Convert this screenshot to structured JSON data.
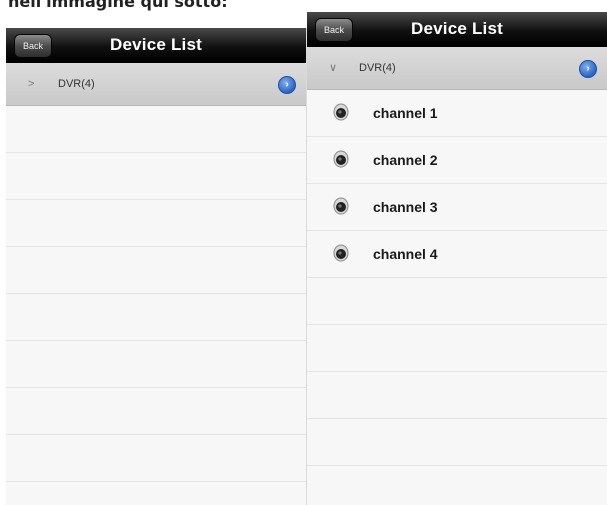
{
  "caption": "nell'immagine qui sotto:",
  "left": {
    "back_label": "Back",
    "title": "Device List",
    "group": {
      "expander": ">",
      "label": "DVR(4)",
      "disclosure": "›"
    }
  },
  "right": {
    "back_label": "Back",
    "title": "Device List",
    "group": {
      "expander": "∨",
      "label": "DVR(4)",
      "disclosure": "›"
    },
    "channels": [
      {
        "label": "channel 1",
        "icon": "camera-icon"
      },
      {
        "label": "channel 2",
        "icon": "camera-icon"
      },
      {
        "label": "channel 3",
        "icon": "camera-icon"
      },
      {
        "label": "channel 4",
        "icon": "camera-icon"
      }
    ]
  },
  "colors": {
    "navbar": "#000000",
    "disclosure": "#2a64c9",
    "group_row": "#cfcfcf"
  }
}
